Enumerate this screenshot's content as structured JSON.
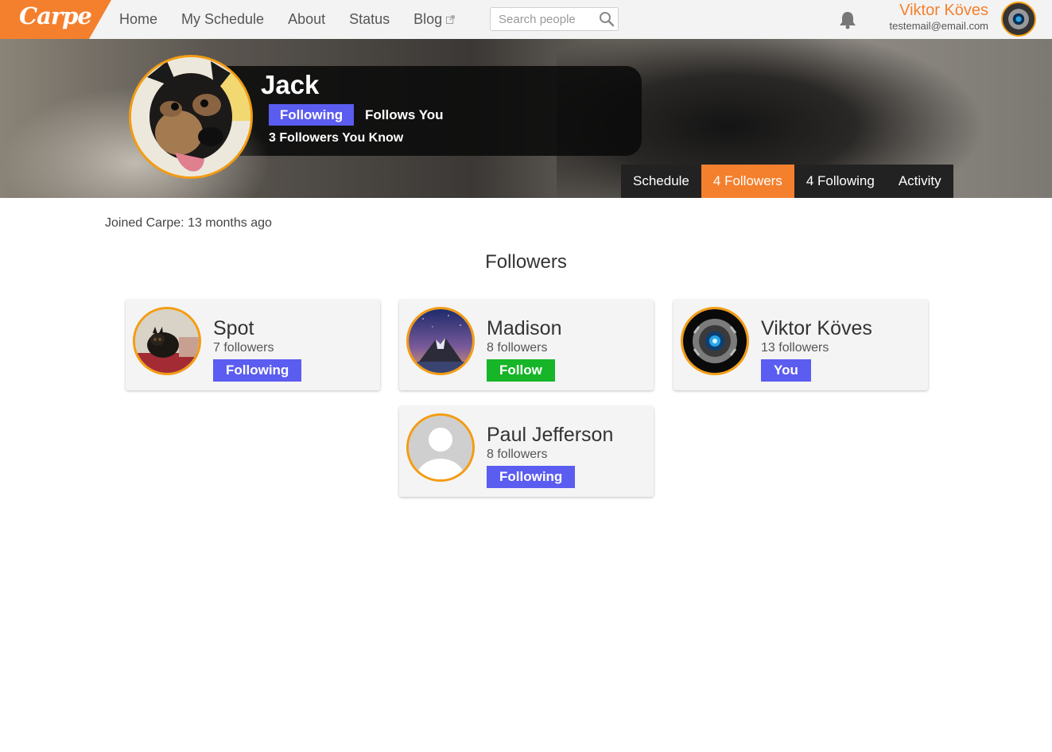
{
  "brand": {
    "logo_text": "Carpe"
  },
  "nav": {
    "items": [
      {
        "label": "Home"
      },
      {
        "label": "My Schedule"
      },
      {
        "label": "About"
      },
      {
        "label": "Status"
      },
      {
        "label": "Blog"
      }
    ]
  },
  "search": {
    "placeholder": "Search people",
    "value": ""
  },
  "user": {
    "name": "Viktor Köves",
    "email": "testemail@email.com"
  },
  "profile": {
    "name": "Jack",
    "following_label": "Following",
    "follows_you_label": "Follows You",
    "mutuals_label": "3 Followers You Know"
  },
  "tabs": [
    {
      "label": "Schedule",
      "active": false
    },
    {
      "label": "4 Followers",
      "active": true
    },
    {
      "label": "4 Following",
      "active": false
    },
    {
      "label": "Activity",
      "active": false
    }
  ],
  "joined": "Joined Carpe: 13 months ago",
  "section_title": "Followers",
  "followers": [
    {
      "name": "Spot",
      "count": "7 followers",
      "button": "Following",
      "button_color": "#5b5cf0"
    },
    {
      "name": "Madison",
      "count": "8 followers",
      "button": "Follow",
      "button_color": "#17b528"
    },
    {
      "name": "Viktor Köves",
      "count": "13 followers",
      "button": "You",
      "button_color": "#5b5cf0"
    },
    {
      "name": "Paul Jefferson",
      "count": "8 followers",
      "button": "Following",
      "button_color": "#5b5cf0"
    }
  ],
  "colors": {
    "accent": "#f4802e",
    "avatar_ring": "#f39c12",
    "primary_button": "#5b5cf0",
    "follow_button": "#17b528"
  },
  "icons": [
    "search-icon",
    "bell-icon",
    "external-link-icon"
  ]
}
